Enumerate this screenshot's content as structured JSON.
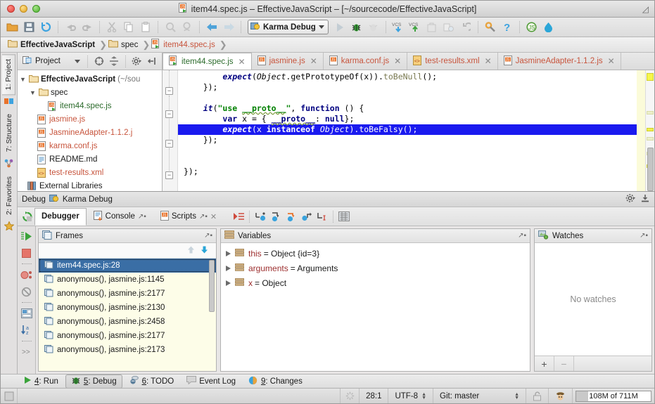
{
  "window": {
    "title": "item44.spec.js – EffectiveJavaScript – [~/sourcecode/EffectiveJavaScript]",
    "file_icon": "js-spec-icon"
  },
  "toolbar": {
    "buttons": [
      {
        "name": "open-folder-icon",
        "label": "Open"
      },
      {
        "name": "save-all-icon",
        "label": "Save All"
      },
      {
        "name": "sync-icon",
        "label": "Synchronize"
      },
      {
        "name": "undo-icon",
        "label": "Undo"
      },
      {
        "name": "redo-icon",
        "label": "Redo"
      },
      {
        "name": "cut-icon",
        "label": "Cut"
      },
      {
        "name": "copy-icon",
        "label": "Copy"
      },
      {
        "name": "paste-icon",
        "label": "Paste"
      },
      {
        "name": "find-icon",
        "label": "Find"
      },
      {
        "name": "replace-icon",
        "label": "Replace"
      },
      {
        "name": "back-icon",
        "label": "Back"
      },
      {
        "name": "forward-icon",
        "label": "Forward"
      }
    ],
    "run_config": "Karma Debug",
    "run_label": "Run",
    "debug_label": "Debug",
    "coverage_label": "Run with Coverage",
    "vcs_update_label": "VCS",
    "vcs_commit_label": "VCS",
    "settings_label": "Settings",
    "help_label": "?",
    "js_label": "JS",
    "extra_label": "Extra"
  },
  "breadcrumb": {
    "items": [
      {
        "label": "EffectiveJavaScript",
        "icon": "folder-icon",
        "bold": true
      },
      {
        "label": "spec",
        "icon": "folder-icon",
        "bold": false
      },
      {
        "label": "item44.spec.js",
        "icon": "js-spec-icon",
        "bold": false
      }
    ],
    "separator": "›"
  },
  "left_strip": {
    "tabs": [
      {
        "label": "1: Project",
        "icon": "project-icon",
        "active": true
      },
      {
        "label": "7: Structure",
        "icon": "structure-icon",
        "active": false
      },
      {
        "label": "2: Favorites",
        "icon": "star-icon",
        "active": false
      }
    ]
  },
  "project_panel": {
    "title": "Project",
    "toolbar_icons": [
      "target-icon",
      "collapse-all-icon",
      "gear-icon",
      "hide-icon"
    ],
    "tree": [
      {
        "depth": 0,
        "twisty": "▼",
        "icon": "folder-icon",
        "label": "EffectiveJavaScript",
        "suffix": " (~/sou",
        "bold": true,
        "color": "black"
      },
      {
        "depth": 1,
        "twisty": "▼",
        "icon": "folder-icon",
        "label": "spec",
        "suffix": "",
        "bold": false,
        "color": "black"
      },
      {
        "depth": 2,
        "twisty": "",
        "icon": "js-spec-icon",
        "label": "item44.spec.js",
        "suffix": "",
        "bold": false,
        "color": "green"
      },
      {
        "depth": 1,
        "twisty": "",
        "icon": "js-icon",
        "label": "jasmine.js",
        "suffix": "",
        "bold": false,
        "color": "red"
      },
      {
        "depth": 1,
        "twisty": "",
        "icon": "js-icon",
        "label": "JasmineAdapter-1.1.2.j",
        "suffix": "",
        "bold": false,
        "color": "red"
      },
      {
        "depth": 1,
        "twisty": "",
        "icon": "js-icon",
        "label": "karma.conf.js",
        "suffix": "",
        "bold": false,
        "color": "red"
      },
      {
        "depth": 1,
        "twisty": "",
        "icon": "md-icon",
        "label": "README.md",
        "suffix": "",
        "bold": false,
        "color": "black"
      },
      {
        "depth": 1,
        "twisty": "",
        "icon": "xml-icon",
        "label": "test-results.xml",
        "suffix": "",
        "bold": false,
        "color": "red"
      },
      {
        "depth": 0,
        "twisty": "",
        "icon": "libraries-icon",
        "label": "External Libraries",
        "suffix": "",
        "bold": false,
        "color": "black"
      }
    ]
  },
  "editor_tabs": [
    {
      "label": "item44.spec.js",
      "icon": "js-spec-icon",
      "active": true
    },
    {
      "label": "jasmine.js",
      "icon": "js-icon",
      "active": false
    },
    {
      "label": "karma.conf.js",
      "icon": "js-icon",
      "active": false
    },
    {
      "label": "test-results.xml",
      "icon": "xml-icon",
      "active": false
    },
    {
      "label": "JasmineAdapter-1.1.2.js",
      "icon": "js-icon",
      "active": false
    }
  ],
  "code": {
    "lines": [
      {
        "indent": 0,
        "highlight": false,
        "tokens": [
          {
            "t": "        ",
            "c": "plain"
          },
          {
            "t": "expect",
            "c": "fn"
          },
          {
            "t": "(",
            "c": "plain"
          },
          {
            "t": "Object",
            "c": "cls"
          },
          {
            "t": ".getPrototypeOf(",
            "c": "plain"
          },
          {
            "t": "x",
            "c": "plain"
          },
          {
            "t": ")).",
            "c": "plain"
          },
          {
            "t": "toBeNull",
            "c": "mth"
          },
          {
            "t": "();",
            "c": "plain"
          }
        ]
      },
      {
        "indent": 0,
        "highlight": false,
        "tokens": [
          {
            "t": "    });",
            "c": "plain"
          }
        ]
      },
      {
        "indent": 0,
        "highlight": false,
        "tokens": [
          {
            "t": "",
            "c": "plain"
          }
        ]
      },
      {
        "indent": 0,
        "highlight": false,
        "tokens": [
          {
            "t": "    ",
            "c": "plain"
          },
          {
            "t": "it",
            "c": "fn"
          },
          {
            "t": "(",
            "c": "plain"
          },
          {
            "t": "\"use ",
            "c": "str"
          },
          {
            "t": "__proto__",
            "c": "str wavy"
          },
          {
            "t": "\"",
            "c": "str"
          },
          {
            "t": ", ",
            "c": "plain"
          },
          {
            "t": "function",
            "c": "kw"
          },
          {
            "t": " () {",
            "c": "plain"
          }
        ]
      },
      {
        "indent": 0,
        "highlight": false,
        "tokens": [
          {
            "t": "        ",
            "c": "plain"
          },
          {
            "t": "var",
            "c": "kw"
          },
          {
            "t": " x = { ",
            "c": "plain"
          },
          {
            "t": "__proto__",
            "c": "kw wavy"
          },
          {
            "t": ": ",
            "c": "plain"
          },
          {
            "t": "null",
            "c": "kw"
          },
          {
            "t": "};",
            "c": "plain"
          }
        ]
      },
      {
        "indent": 0,
        "highlight": true,
        "tokens": [
          {
            "t": "        ",
            "c": "plain"
          },
          {
            "t": "expect",
            "c": "fn"
          },
          {
            "t": "(x ",
            "c": "plain"
          },
          {
            "t": "instanceof",
            "c": "kw"
          },
          {
            "t": " ",
            "c": "plain"
          },
          {
            "t": "Object",
            "c": "cls"
          },
          {
            "t": ").",
            "c": "plain"
          },
          {
            "t": "toBeFalsy",
            "c": "mth"
          },
          {
            "t": "();",
            "c": "plain"
          }
        ]
      },
      {
        "indent": 0,
        "highlight": false,
        "tokens": [
          {
            "t": "    });",
            "c": "plain"
          }
        ]
      },
      {
        "indent": 0,
        "highlight": false,
        "tokens": [
          {
            "t": "",
            "c": "plain"
          }
        ]
      },
      {
        "indent": 0,
        "highlight": false,
        "tokens": [
          {
            "t": "",
            "c": "plain"
          }
        ]
      },
      {
        "indent": 0,
        "highlight": false,
        "tokens": [
          {
            "t": "});",
            "c": "plain"
          }
        ]
      }
    ]
  },
  "debug_panel": {
    "header_label": "Debug",
    "config_label": "Karma Debug",
    "config_icon": "run-config-icon",
    "settings_icon": "gear-icon",
    "hide_icon": "hide-icon",
    "tabs": [
      {
        "label": "Debugger",
        "icon": "",
        "active": true,
        "pin": false,
        "close": false
      },
      {
        "label": "Console",
        "icon": "console-icon",
        "active": false,
        "pin": true,
        "close": false
      },
      {
        "label": "Scripts",
        "icon": "js-icon",
        "active": false,
        "pin": true,
        "close": true
      }
    ],
    "toolbar_icons": [
      "show-execution-point-icon",
      "step-over-icon",
      "step-into-icon",
      "force-step-into-icon",
      "step-out-icon",
      "run-to-cursor-icon",
      "evaluate-icon"
    ],
    "side_icons": [
      "resume-program-icon",
      "stop-icon",
      "view-breakpoints-icon",
      "mute-breakpoints-icon",
      "settings-layout-icon",
      "sort-alpha-icon",
      "more-icon"
    ]
  },
  "frames": {
    "title": "Frames",
    "up_label": "Up",
    "down_label": "Down",
    "items": [
      {
        "label": "item44.spec.js:28",
        "selected": true
      },
      {
        "label": "anonymous(), jasmine.js:1145",
        "selected": false
      },
      {
        "label": "anonymous(), jasmine.js:2177",
        "selected": false
      },
      {
        "label": "anonymous(), jasmine.js:2130",
        "selected": false
      },
      {
        "label": "anonymous(), jasmine.js:2458",
        "selected": false
      },
      {
        "label": "anonymous(), jasmine.js:2177",
        "selected": false
      },
      {
        "label": "anonymous(), jasmine.js:2173",
        "selected": false
      }
    ]
  },
  "variables": {
    "title": "Variables",
    "items": [
      {
        "name": "this",
        "value": " = Object {id=3}"
      },
      {
        "name": "arguments",
        "value": " = Arguments"
      },
      {
        "name": "x",
        "value": " = Object"
      }
    ]
  },
  "watches": {
    "title": "Watches",
    "empty_text": "No watches",
    "add_label": "+",
    "remove_label": "−"
  },
  "tool_window_bar": {
    "items": [
      {
        "key": "4",
        "label": ": Run",
        "icon": "run-icon",
        "active": false
      },
      {
        "key": "5",
        "label": ": Debug",
        "icon": "debug-icon",
        "active": true
      },
      {
        "key": "6",
        "label": ": TODO",
        "icon": "todo-icon",
        "active": false
      },
      {
        "key": "",
        "label": "Event Log",
        "icon": "event-log-icon",
        "active": false
      },
      {
        "key": "9",
        "label": ": Changes",
        "icon": "changes-icon",
        "active": false
      }
    ]
  },
  "status_bar": {
    "caret_position": "28:1",
    "encoding": "UTF-8",
    "vcs_branch": "Git: master",
    "lock_icon": "unlocked-icon",
    "inspector_icon": "detective-icon",
    "memory": "108M of 711M"
  },
  "colors": {
    "selection_blue": "#1a1aef",
    "frame_selection": "#3a6ea5",
    "js_file_red": "#c7543c",
    "spec_green": "#2b6b2b",
    "warning_yellow": "#f0f04c",
    "frames_bg": "#fdfde8"
  }
}
